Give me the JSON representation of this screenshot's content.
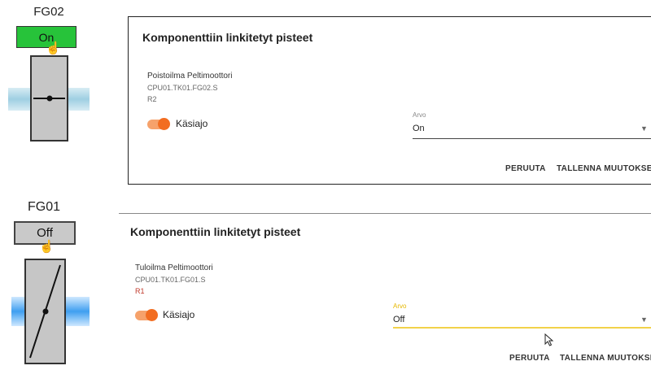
{
  "widgets": [
    {
      "title": "FG02",
      "button_label": "On",
      "hand_icon": "hand-pointer-icon"
    },
    {
      "title": "FG01",
      "button_label": "Off",
      "hand_icon": "hand-pointer-icon"
    }
  ],
  "dialogs": [
    {
      "title": "Komponenttiin linkitetyt pisteet",
      "point_name": "Poistoilma Peltimoottori",
      "point_id": "CPU01.TK01.FG02.S",
      "point_ref": "R2",
      "switch_label": "Käsiajo",
      "field_label": "Arvo",
      "field_value": "On",
      "cancel_label": "PERUUTA",
      "save_label": "TALLENNA MUUTOKSET"
    },
    {
      "title": "Komponenttiin linkitetyt pisteet",
      "point_name": "Tuloilma Peltimoottori",
      "point_id": "CPU01.TK01.FG01.S",
      "point_ref": "R1",
      "switch_label": "Käsiajo",
      "field_label": "Arvo",
      "field_value": "Off",
      "cancel_label": "PERUUTA",
      "save_label": "TALLENNA MUUTOKSET"
    }
  ],
  "colors": {
    "on_green": "#27c33a",
    "switch_orange": "#f26d21",
    "focus_yellow": "#f2d24a"
  }
}
